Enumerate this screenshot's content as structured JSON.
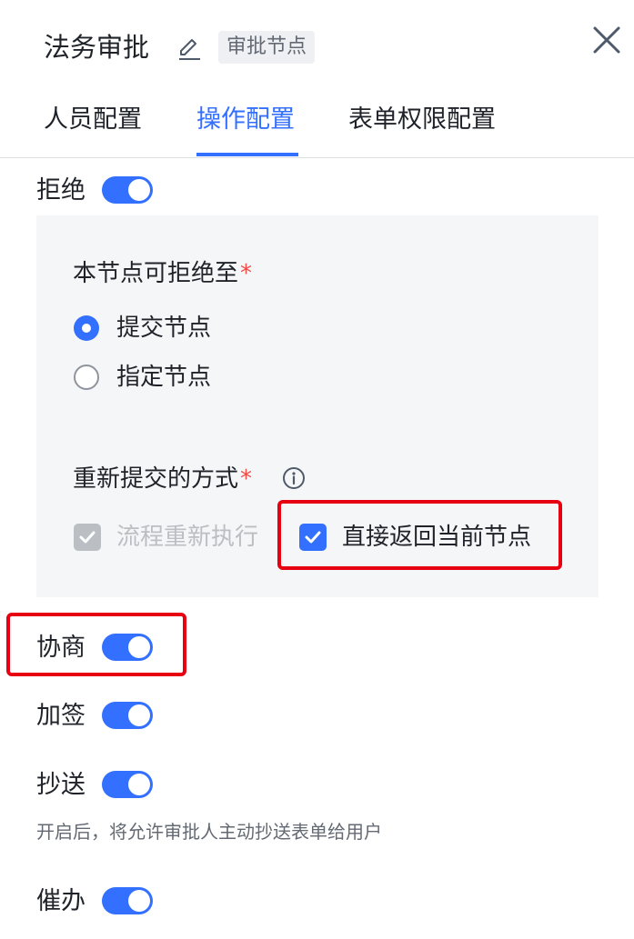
{
  "header": {
    "title": "法务审批",
    "tag": "审批节点"
  },
  "tabs": [
    {
      "label": "人员配置",
      "active": false
    },
    {
      "label": "操作配置",
      "active": true
    },
    {
      "label": "表单权限配置",
      "active": false
    }
  ],
  "reject": {
    "label": "拒绝",
    "enabled": true,
    "target_label": "本节点可拒绝至",
    "target_options": [
      {
        "label": "提交节点",
        "selected": true
      },
      {
        "label": "指定节点",
        "selected": false
      }
    ],
    "resubmit_label": "重新提交的方式",
    "resubmit_options": [
      {
        "label": "流程重新执行",
        "checked": true,
        "disabled": true
      },
      {
        "label": "直接返回当前节点",
        "checked": true,
        "disabled": false
      }
    ]
  },
  "negotiate": {
    "label": "协商",
    "enabled": true
  },
  "add_sign": {
    "label": "加签",
    "enabled": true
  },
  "cc": {
    "label": "抄送",
    "enabled": true,
    "hint": "开启后，将允许审批人主动抄送表单给用户"
  },
  "urge": {
    "label": "催办",
    "enabled": true
  },
  "colors": {
    "accent": "#3370ff",
    "highlight": "#e60012",
    "required": "#f54a45"
  }
}
